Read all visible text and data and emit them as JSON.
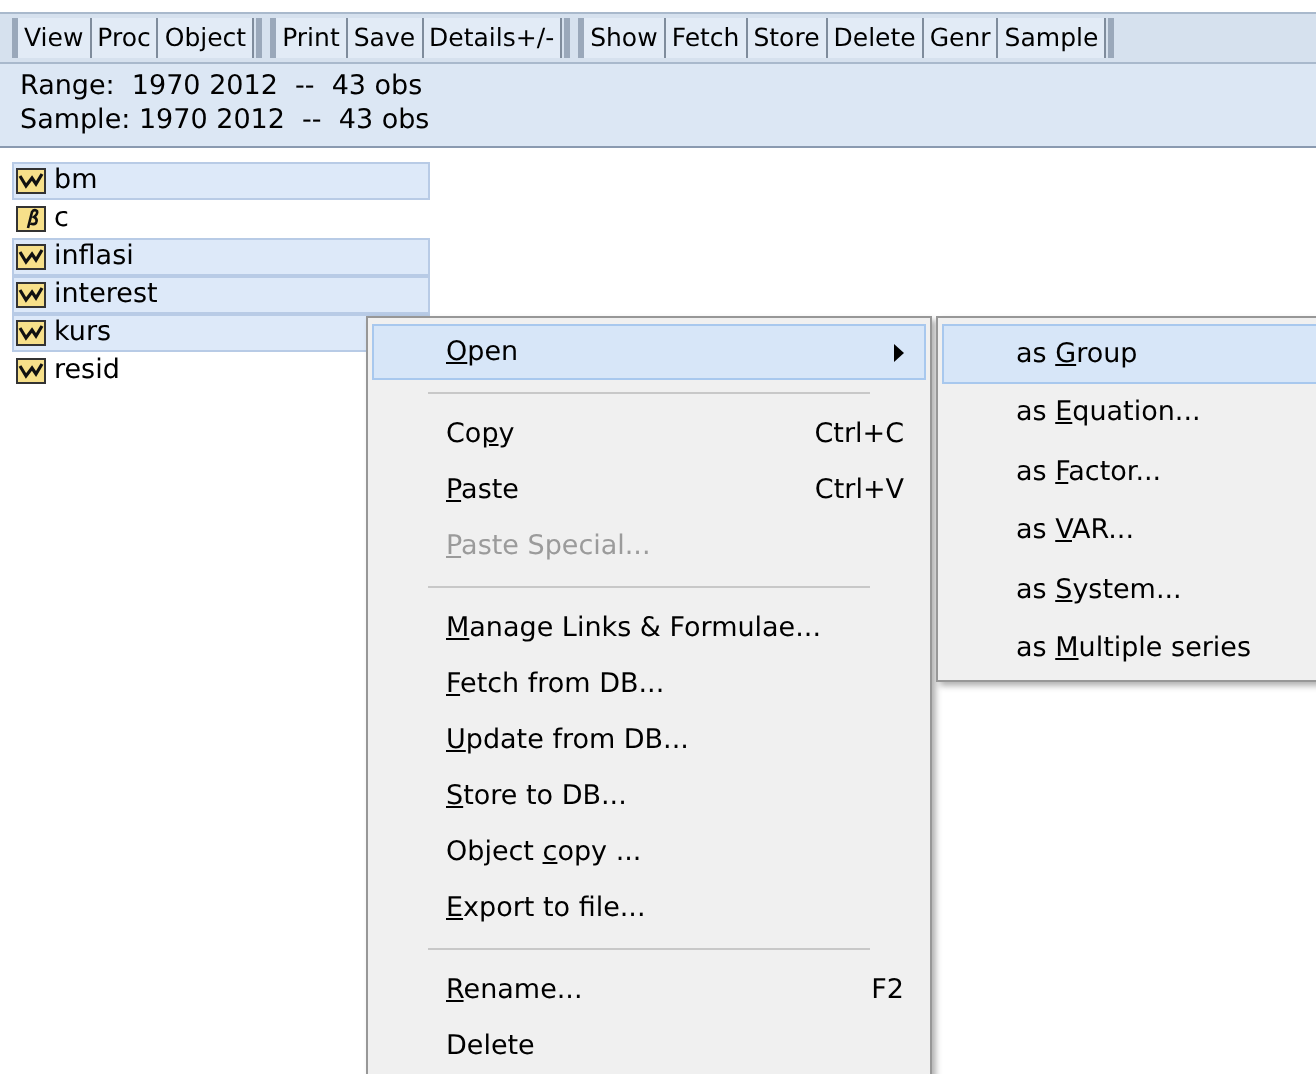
{
  "toolbar": [
    [
      "View",
      "Proc",
      "Object"
    ],
    [
      "Print",
      "Save",
      "Details+/-"
    ],
    [
      "Show",
      "Fetch",
      "Store",
      "Delete",
      "Genr",
      "Sample"
    ]
  ],
  "info": [
    "Range:  1970 2012  --  43 obs",
    "Sample: 1970 2012  --  43 obs"
  ],
  "objects": [
    {
      "name": "bm",
      "kind": "series",
      "selected": true
    },
    {
      "name": "c",
      "kind": "coef",
      "selected": false
    },
    {
      "name": "inflasi",
      "kind": "series",
      "selected": true
    },
    {
      "name": "interest",
      "kind": "series",
      "selected": true
    },
    {
      "name": "kurs",
      "kind": "series",
      "selected": true
    },
    {
      "name": "resid",
      "kind": "series",
      "selected": false
    }
  ],
  "context_menu": [
    {
      "kind": "item",
      "key": "O",
      "after": "pen",
      "submenu": true,
      "selected": true,
      "disabled": false
    },
    {
      "kind": "separator"
    },
    {
      "kind": "item",
      "before": "Co",
      "key": "p",
      "after": "y",
      "shortcut": "Ctrl+C",
      "submenu": false,
      "selected": false,
      "disabled": false
    },
    {
      "kind": "item",
      "key": "P",
      "after": "aste",
      "shortcut": "Ctrl+V",
      "submenu": false,
      "selected": false,
      "disabled": false
    },
    {
      "kind": "item",
      "key": "P",
      "after": "aste Special...",
      "submenu": false,
      "selected": false,
      "disabled": true
    },
    {
      "kind": "separator"
    },
    {
      "kind": "item",
      "key": "M",
      "after": "anage Links & Formulae...",
      "submenu": false,
      "selected": false,
      "disabled": false
    },
    {
      "kind": "item",
      "key": "F",
      "after": "etch from DB...",
      "submenu": false,
      "selected": false,
      "disabled": false
    },
    {
      "kind": "item",
      "key": "U",
      "after": "pdate from DB...",
      "submenu": false,
      "selected": false,
      "disabled": false
    },
    {
      "kind": "item",
      "key": "S",
      "after": "tore to DB...",
      "submenu": false,
      "selected": false,
      "disabled": false
    },
    {
      "kind": "item",
      "before": "Object ",
      "key": "c",
      "after": "opy ...",
      "submenu": false,
      "selected": false,
      "disabled": false
    },
    {
      "kind": "item",
      "key": "E",
      "after": "xport to file...",
      "submenu": false,
      "selected": false,
      "disabled": false
    },
    {
      "kind": "separator"
    },
    {
      "kind": "item",
      "key": "R",
      "after": "ename...",
      "shortcut": "F2",
      "submenu": false,
      "selected": false,
      "disabled": false
    },
    {
      "kind": "item",
      "before": "Delete",
      "submenu": false,
      "selected": false,
      "disabled": false
    }
  ],
  "submenu": [
    {
      "before": "as ",
      "key": "G",
      "after": "roup",
      "selected": true
    },
    {
      "before": "as ",
      "key": "E",
      "after": "quation...",
      "selected": false
    },
    {
      "before": "as ",
      "key": "F",
      "after": "actor...",
      "selected": false
    },
    {
      "before": "as ",
      "key": "V",
      "after": "AR...",
      "selected": false
    },
    {
      "before": "as ",
      "key": "S",
      "after": "ystem...",
      "selected": false
    },
    {
      "before": "as ",
      "key": "M",
      "after": "ultiple series",
      "selected": false
    }
  ]
}
